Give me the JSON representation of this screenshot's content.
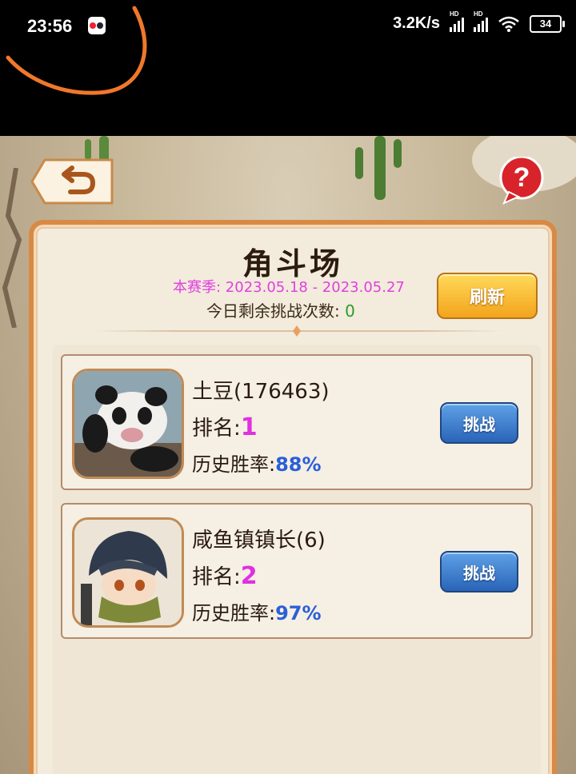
{
  "status_bar": {
    "time": "23:56",
    "net_speed": "3.2K/s",
    "signal_hd_1": "HD",
    "signal_hd_2": "HD",
    "battery": "34"
  },
  "panel": {
    "title": "角斗场",
    "season": "本赛季: 2023.05.18 - 2023.05.27",
    "remaining_label": "今日剩余挑战次数: ",
    "remaining_count": "0",
    "refresh_label": "刷新"
  },
  "players": [
    {
      "name": "土豆(176463)",
      "rank_label": "排名:",
      "rank": "1",
      "win_label": "历史胜率:",
      "win_rate": "88%",
      "challenge_label": "挑战"
    },
    {
      "name": "咸鱼镇镇长(6)",
      "rank_label": "排名:",
      "rank": "2",
      "win_label": "历史胜率:",
      "win_rate": "97%",
      "challenge_label": "挑战"
    }
  ],
  "help_label": "?",
  "colors": {
    "accent_orange": "#d88a45",
    "refresh_gold": "#f3a41c",
    "challenge_blue": "#2a64b8",
    "rank_magenta": "#e030e0",
    "win_blue": "#2a5fd8",
    "count_green": "#2e9a2e",
    "annotation_orange": "#f0782a"
  },
  "icons": {
    "back": "back-arrow-icon",
    "help": "help-question-icon",
    "wifi": "wifi-icon",
    "battery": "battery-icon"
  }
}
